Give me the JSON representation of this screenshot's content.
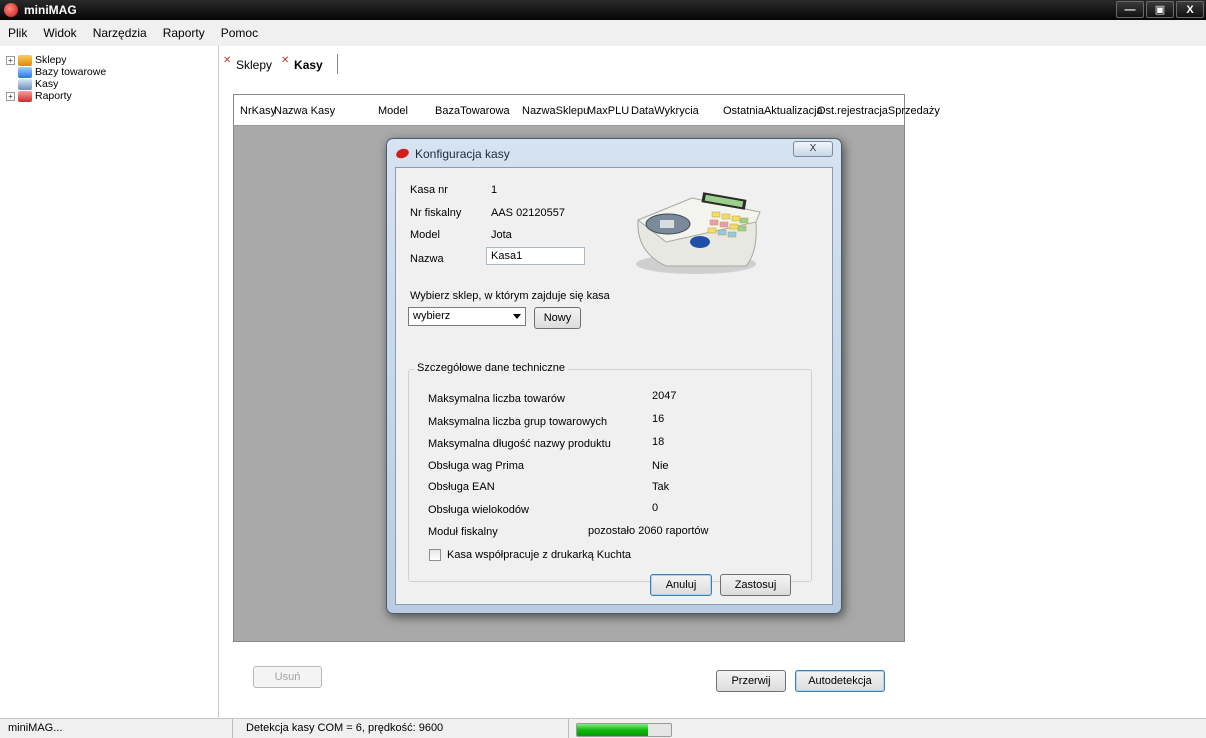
{
  "window": {
    "title": "miniMAG",
    "buttons": [
      "—",
      "▣",
      "X"
    ]
  },
  "menu": [
    "Plik",
    "Widok",
    "Narzędzia",
    "Raporty",
    "Pomoc"
  ],
  "tree": [
    {
      "label": "Sklepy",
      "icon": "shop-icon",
      "expandable": true
    },
    {
      "label": "Bazy towarowe",
      "icon": "database-icon",
      "expandable": false
    },
    {
      "label": "Kasy",
      "icon": "cash-register-icon",
      "expandable": false
    },
    {
      "label": "Raporty",
      "icon": "report-icon",
      "expandable": true
    }
  ],
  "tabs": [
    {
      "label": "Sklepy",
      "active": false
    },
    {
      "label": "Kasy",
      "active": true
    }
  ],
  "table": {
    "columns": [
      [
        "Nr",
        "Kasy"
      ],
      [
        "Nazwa Kasy",
        ""
      ],
      [
        "Model",
        ""
      ],
      [
        "Baza",
        "Towarowa"
      ],
      [
        "Nazwa",
        "Sklepu"
      ],
      [
        "Max",
        "PLU"
      ],
      [
        "Data",
        "Wykrycia"
      ],
      [
        "Ostatnia",
        "Aktualizacja"
      ],
      [
        "Ost.rejestracja",
        "Sprzedaży"
      ]
    ]
  },
  "dialog": {
    "title": "Konfiguracja kasy",
    "close": "X",
    "kasa_nr_label": "Kasa nr",
    "kasa_nr_value": "1",
    "nr_fiskalny_label": "Nr fiskalny",
    "nr_fiskalny_value": "AAS 02120557",
    "model_label": "Model",
    "model_value": "Jota",
    "nazwa_label": "Nazwa",
    "nazwa_value": "Kasa1",
    "shop_prompt": "Wybierz sklep, w którym zajduje się kasa",
    "shop_select": "wybierz",
    "new_button": "Nowy",
    "group_title": "Szczegółowe dane techniczne",
    "details": [
      {
        "label": "Maksymalna liczba towarów",
        "value": "2047"
      },
      {
        "label": "Maksymalna liczba grup towarowych",
        "value": "16"
      },
      {
        "label": "Maksymalna długość nazwy produktu",
        "value": "18"
      },
      {
        "label": "Obsługa wag Prima",
        "value": "Nie"
      },
      {
        "label": "Obsługa EAN",
        "value": "Tak"
      },
      {
        "label": "Obsługa wielokodów",
        "value": "0"
      },
      {
        "label": "Moduł fiskalny",
        "value": "pozostało 2060 raportów"
      }
    ],
    "checkbox_label": "Kasa współpracuje z drukarką Kuchta",
    "checkbox_checked": false,
    "cancel_button": "Anuluj",
    "apply_button": "Zastosuj"
  },
  "bottom": {
    "delete_button": "Usuń",
    "stop_button": "Przerwij",
    "autodetect_button": "Autodetekcja"
  },
  "statusbar": {
    "left": "miniMAG...",
    "message": "Detekcja kasy COM = 6, prędkość: 9600",
    "progress": 0.75
  }
}
